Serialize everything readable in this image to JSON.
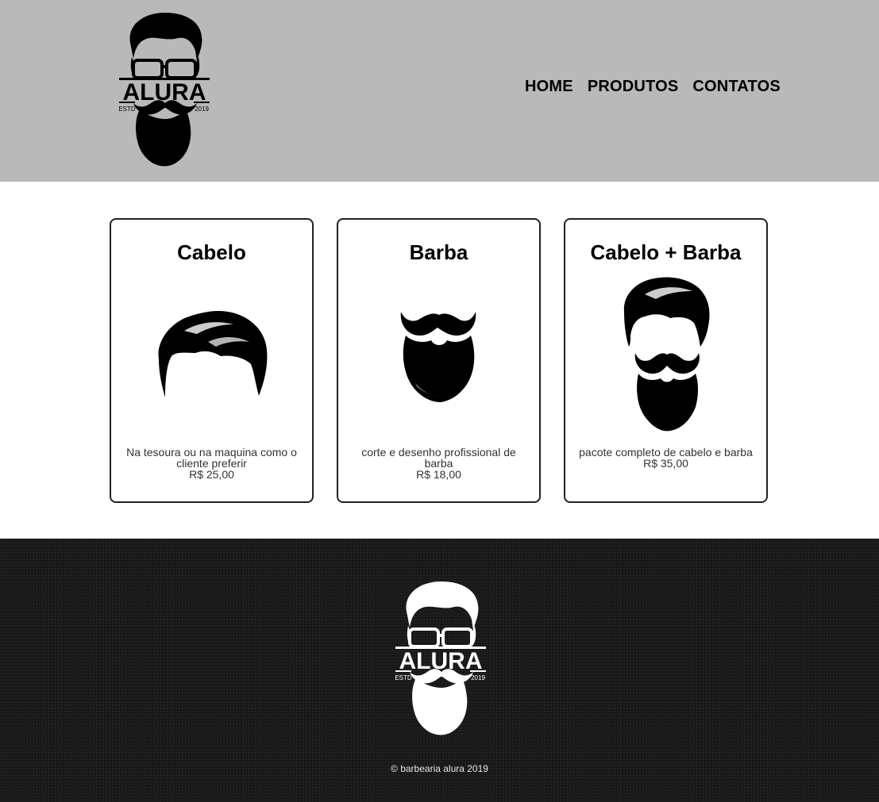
{
  "header": {
    "logo": {
      "brand": "ALURA",
      "left_text": "ESTD",
      "right_text": "2019",
      "icon": "bearded-man-logo-icon"
    },
    "nav": [
      {
        "label": "HOME"
      },
      {
        "label": "PRODUTOS"
      },
      {
        "label": "CONTATOS"
      }
    ]
  },
  "products": [
    {
      "title": "Cabelo",
      "icon": "hair-icon",
      "description": "Na tesoura ou na maquina como o cliente preferir",
      "price": "R$ 25,00"
    },
    {
      "title": "Barba",
      "icon": "beard-icon",
      "description": "corte e desenho profissional de barba",
      "price": "R$ 18,00"
    },
    {
      "title": "Cabelo + Barba",
      "icon": "hair-and-beard-icon",
      "description": "pacote completo de cabelo e barba",
      "price": "R$ 35,00"
    }
  ],
  "footer": {
    "logo": {
      "brand": "ALURA",
      "left_text": "ESTD",
      "right_text": "2019",
      "icon": "bearded-man-logo-icon"
    },
    "copyright": "© barbearia alura 2019"
  },
  "colors": {
    "header_bg": "#b9b9b9",
    "footer_bg": "#1c1c1c",
    "card_border": "#222222"
  }
}
